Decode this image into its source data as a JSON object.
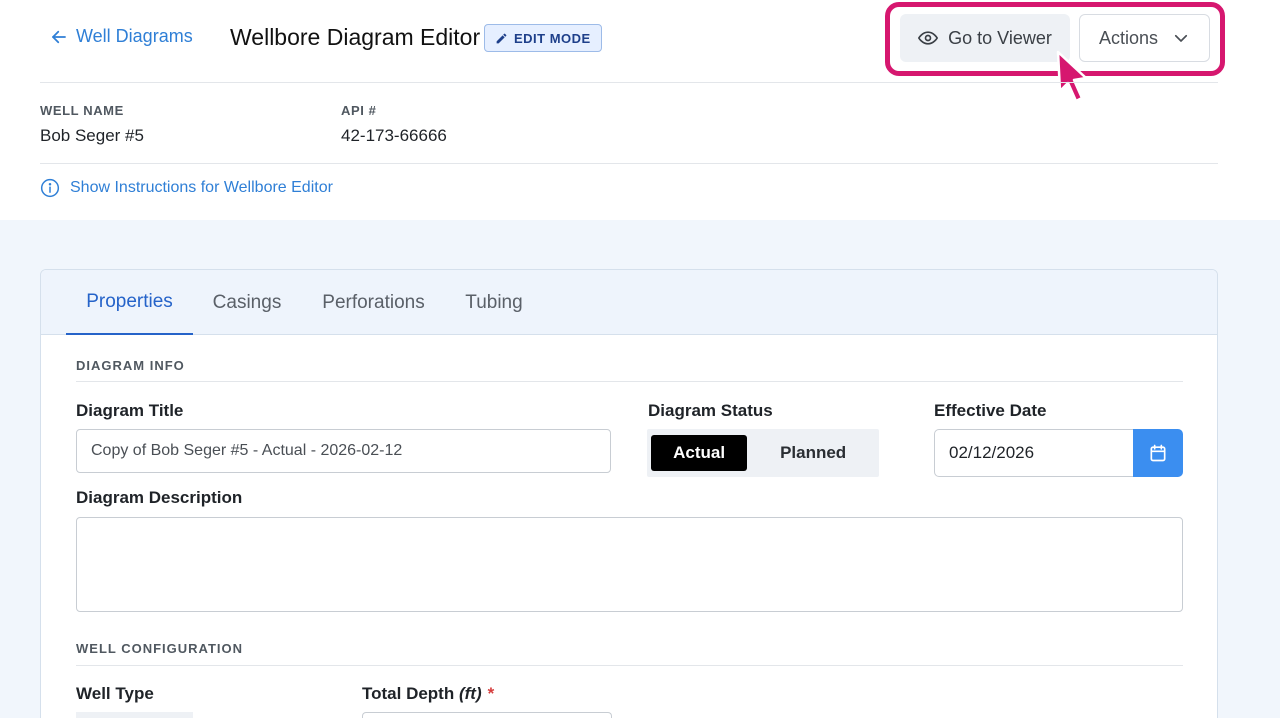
{
  "header": {
    "back_label": "Well Diagrams",
    "title": "Wellbore Diagram Editor",
    "mode_badge": "EDIT MODE",
    "viewer_button": "Go to Viewer",
    "actions_button": "Actions",
    "accent_color": "#2f7fd6",
    "highlight_color": "#d6176f"
  },
  "well": {
    "name_label": "WELL NAME",
    "name_value": "Bob Seger #5",
    "api_label": "API #",
    "api_value": "42-173-66666"
  },
  "instructions_link": "Show Instructions for Wellbore Editor",
  "tabs": [
    {
      "label": "Properties",
      "active": true
    },
    {
      "label": "Casings",
      "active": false
    },
    {
      "label": "Perforations",
      "active": false
    },
    {
      "label": "Tubing",
      "active": false
    }
  ],
  "diagram_info": {
    "section_label": "DIAGRAM INFO",
    "title_label": "Diagram Title",
    "title_value": "Copy of Bob Seger #5 - Actual - 2026-02-12",
    "status_label": "Diagram Status",
    "status_options": [
      "Actual",
      "Planned"
    ],
    "status_selected": "Actual",
    "date_label": "Effective Date",
    "date_value": "02/12/2026",
    "description_label": "Diagram Description",
    "description_value": ""
  },
  "well_configuration": {
    "section_label": "WELL CONFIGURATION",
    "well_type_label": "Well Type",
    "total_depth_label": "Total Depth",
    "total_depth_unit": "(ft)",
    "required_marker": "*"
  }
}
